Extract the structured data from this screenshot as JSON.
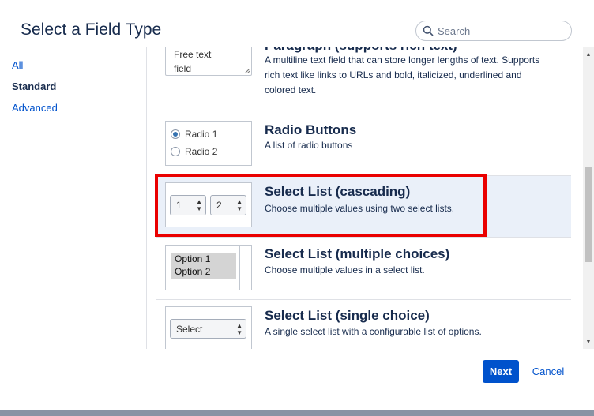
{
  "dialog": {
    "title": "Select a Field Type",
    "search_placeholder": "Search"
  },
  "nav": {
    "items": [
      {
        "label": "All"
      },
      {
        "label": "Standard"
      },
      {
        "label": "Advanced"
      }
    ]
  },
  "fields": [
    {
      "title": "Paragraph (supports rich text)",
      "description": "A multiline text field that can store longer lengths of text. Supports rich text like links to URLs and bold, italicized, underlined and colored text.",
      "preview_text_line1": "Free text",
      "preview_text_line2": "field"
    },
    {
      "title": "Radio Buttons",
      "description": "A list of radio buttons",
      "preview_option1": "Radio 1",
      "preview_option2": "Radio 2"
    },
    {
      "title": "Select List (cascading)",
      "description": "Choose multiple values using two select lists.",
      "preview_value1": "1",
      "preview_value2": "2"
    },
    {
      "title": "Select List (multiple choices)",
      "description": "Choose multiple values in a select list.",
      "preview_option1": "Option 1",
      "preview_option2": "Option 2"
    },
    {
      "title": "Select List (single choice)",
      "description": "A single select list with a configurable list of options.",
      "preview_value": "Select"
    }
  ],
  "footer": {
    "next_label": "Next",
    "cancel_label": "Cancel"
  },
  "colors": {
    "primary": "#0052cc",
    "selected_row": "#eaf0f9",
    "highlight": "#ea0000"
  }
}
